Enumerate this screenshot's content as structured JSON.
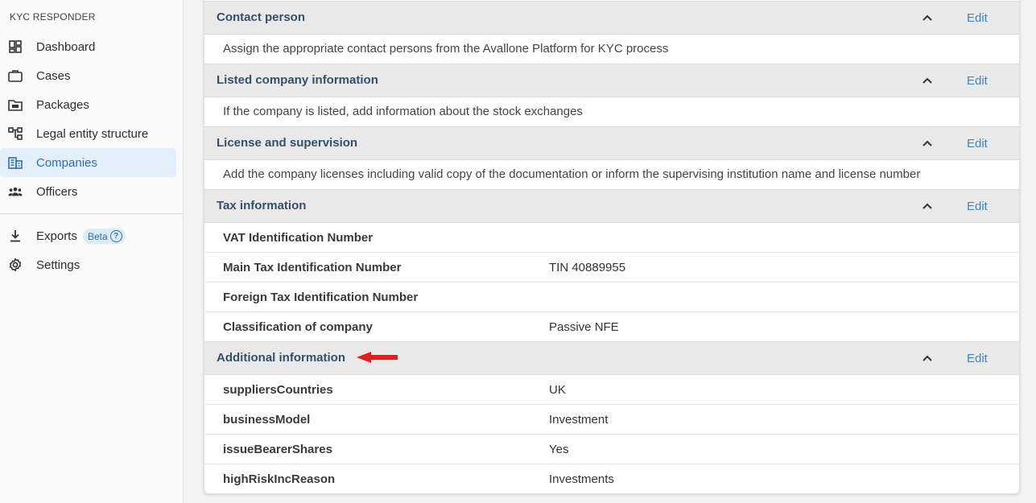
{
  "sidebar": {
    "brand": "KYC RESPONDER",
    "items": [
      {
        "label": "Dashboard",
        "icon": "dashboard-icon"
      },
      {
        "label": "Cases",
        "icon": "briefcase-icon"
      },
      {
        "label": "Packages",
        "icon": "folder-icon"
      },
      {
        "label": "Legal entity structure",
        "icon": "hierarchy-icon"
      },
      {
        "label": "Companies",
        "icon": "building-icon",
        "active": true
      },
      {
        "label": "Officers",
        "icon": "people-icon"
      }
    ],
    "secondary": [
      {
        "label": "Exports",
        "icon": "download-icon",
        "badge": "Beta"
      },
      {
        "label": "Settings",
        "icon": "gear-icon"
      }
    ]
  },
  "sections": {
    "contact": {
      "title": "Contact person",
      "edit": "Edit",
      "desc": "Assign the appropriate contact persons from the Avallone Platform for KYC process"
    },
    "listed": {
      "title": "Listed company information",
      "edit": "Edit",
      "desc": "If the company is listed, add information about the stock exchanges"
    },
    "license": {
      "title": "License and supervision",
      "edit": "Edit",
      "desc": "Add the company licenses including valid copy of the documentation or inform the supervising institution name and license number"
    },
    "tax": {
      "title": "Tax information",
      "edit": "Edit",
      "rows": [
        {
          "k": "VAT Identification Number",
          "v": ""
        },
        {
          "k": "Main Tax Identification Number",
          "v": "TIN 40889955"
        },
        {
          "k": "Foreign Tax Identification Number",
          "v": ""
        },
        {
          "k": "Classification of company",
          "v": "Passive NFE"
        }
      ]
    },
    "additional": {
      "title": "Additional information",
      "edit": "Edit",
      "rows": [
        {
          "k": "suppliersCountries",
          "v": "UK"
        },
        {
          "k": "businessModel",
          "v": "Investment"
        },
        {
          "k": "issueBearerShares",
          "v": "Yes"
        },
        {
          "k": "highRiskIncReason",
          "v": "Investments"
        }
      ]
    }
  },
  "colors": {
    "accent": "#3d86c6",
    "active_bg": "#e3f0fb",
    "header_bg": "#e9e9e9",
    "arrow": "#e02020"
  }
}
